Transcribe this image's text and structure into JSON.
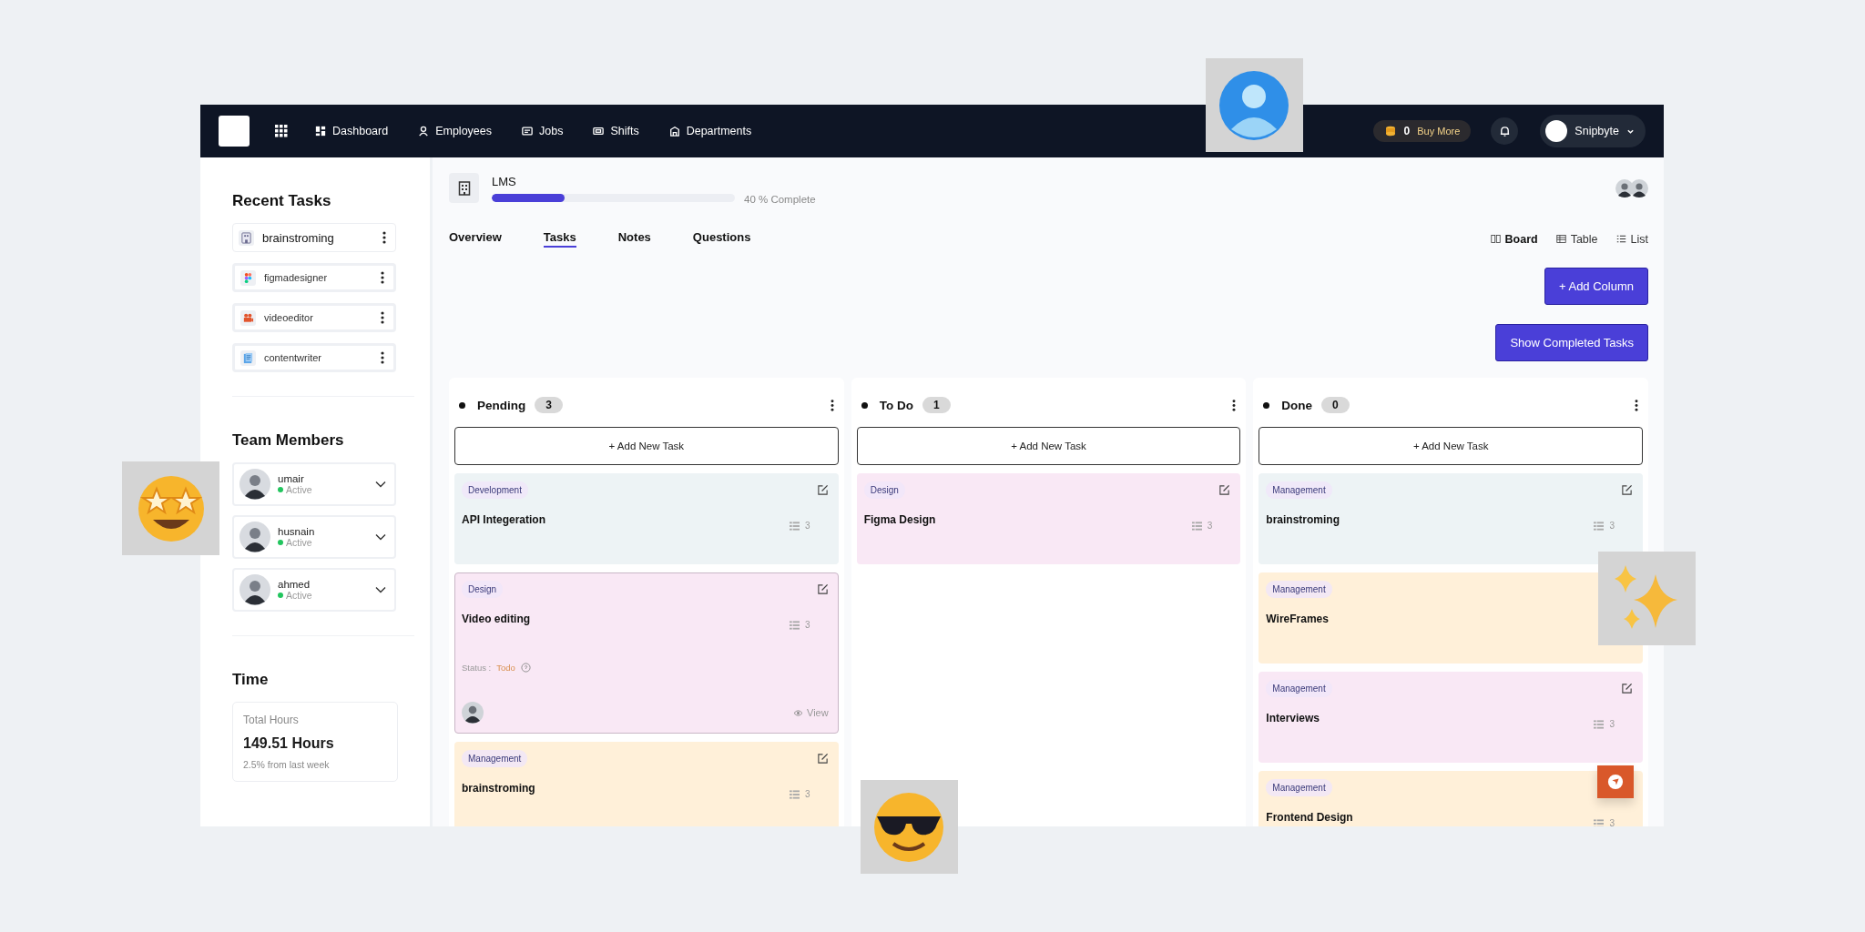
{
  "navbar": {
    "menu": [
      {
        "label": "Dashboard"
      },
      {
        "label": "Employees"
      },
      {
        "label": "Jobs"
      },
      {
        "label": "Shifts"
      },
      {
        "label": "Departments"
      }
    ],
    "credits": "0",
    "buy_more": "Buy More",
    "user": "Snipbyte"
  },
  "sidebar": {
    "recent_title": "Recent Tasks",
    "recent_tasks": [
      {
        "name": "brainstroming",
        "selected": true
      },
      {
        "name": "figmadesigner",
        "selected": false
      },
      {
        "name": "videoeditor",
        "selected": false
      },
      {
        "name": "contentwriter",
        "selected": false
      }
    ],
    "team_title": "Team Members",
    "members": [
      {
        "name": "umair",
        "status": "Active"
      },
      {
        "name": "husnain",
        "status": "Active"
      },
      {
        "name": "ahmed",
        "status": "Active"
      }
    ],
    "time_title": "Time",
    "time": {
      "label": "Total Hours",
      "value": "149.51 Hours",
      "change": "2.5% from last week"
    }
  },
  "project": {
    "name": "LMS",
    "level": 0.3,
    "progress_text": "40 % Complete"
  },
  "tabs": [
    {
      "label": "Overview",
      "selected": false
    },
    {
      "label": "Tasks",
      "selected": true
    },
    {
      "label": "Notes",
      "selected": false
    },
    {
      "label": "Questions",
      "selected": false
    }
  ],
  "views": [
    {
      "label": "Board",
      "selected": true
    },
    {
      "label": "Table",
      "selected": false
    },
    {
      "label": "List",
      "selected": false
    }
  ],
  "actions": [
    "+ Add Column",
    "Show Completed Tasks"
  ],
  "columns": [
    {
      "title": "Pending",
      "count": "3",
      "add": "+ Add New Task",
      "cards": [
        {
          "tag": "Development",
          "title": "API Integeration",
          "subtasks": "3",
          "edit": true,
          "selected": false,
          "color": "#edf3f5"
        },
        {
          "tag": "Design",
          "title": "Video editing",
          "subtasks": "3",
          "edit": true,
          "selected": true,
          "color": "#f9e8f5",
          "status_label": "Status :",
          "status": "Todo",
          "view": "View"
        },
        {
          "tag": "Management",
          "title": "brainstroming",
          "subtasks": "3",
          "edit": true,
          "selected": false,
          "color": "#fff0d9"
        }
      ]
    },
    {
      "title": "To Do",
      "count": "1",
      "add": "+ Add New Task",
      "cards": [
        {
          "tag": "Design",
          "title": "Figma Design",
          "subtasks": "3",
          "edit": true,
          "selected": false,
          "color": "#f9e8f5"
        }
      ]
    },
    {
      "title": "Done",
      "count": "0",
      "add": "+ Add New Task",
      "cards": [
        {
          "tag": "Management",
          "title": "brainstroming",
          "subtasks": "3",
          "edit": true,
          "selected": false,
          "color": "#edf3f5"
        },
        {
          "tag": "Management",
          "title": "WireFrames",
          "edit": false,
          "selected": false,
          "color": "#fff0d9"
        },
        {
          "tag": "Management",
          "title": "Interviews",
          "subtasks": "3",
          "edit": true,
          "selected": false,
          "color": "#f9e8f5"
        },
        {
          "tag": "Management",
          "title": "Frontend Design",
          "subtasks": "3",
          "edit": false,
          "selected": false,
          "color": "#fff0d9"
        }
      ]
    }
  ]
}
